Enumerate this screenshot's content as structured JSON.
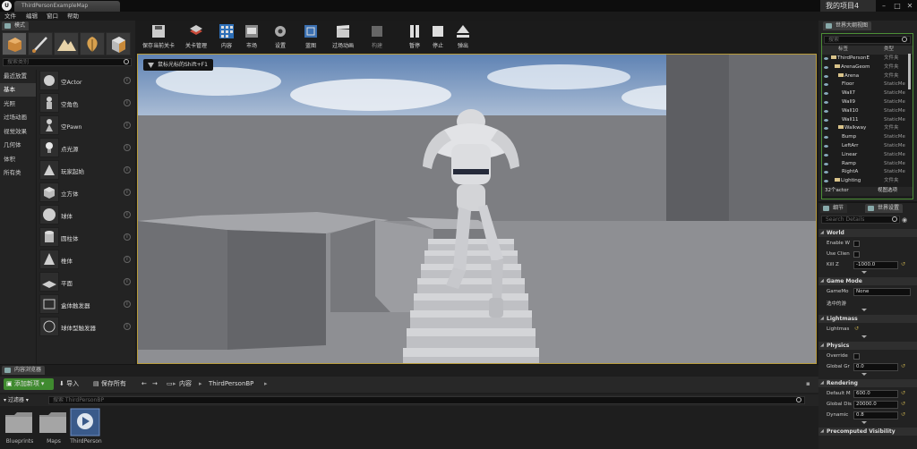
{
  "titlebar": {
    "doc_tab": "ThirdPersonExampleMap",
    "project": "我的项目4",
    "logo": "U"
  },
  "menu": [
    "文件",
    "编辑",
    "窗口",
    "帮助"
  ],
  "modes_panel": {
    "tab_label": "模式",
    "search_placeholder": "搜索类别",
    "categories": [
      "最近放置",
      "基本",
      "光照",
      "过场动画",
      "视觉效果",
      "几何体",
      "体积",
      "所有类"
    ],
    "items": [
      "空Actor",
      "空角色",
      "空Pawn",
      "点光源",
      "玩家起始",
      "立方体",
      "球体",
      "圆柱体",
      "椎体",
      "平面",
      "盒体触发器",
      "球体型触发器"
    ]
  },
  "toolbar": {
    "buttons": [
      "保存当前关卡",
      "关卡管理",
      "内容",
      "市场",
      "设置",
      "蓝图",
      "过场动画",
      "构建",
      "暂停",
      "停止",
      "弹出"
    ]
  },
  "viewport": {
    "hint": "鼠标光标的Shift+F1"
  },
  "outliner": {
    "tab_label": "世界大纲视图",
    "search_placeholder": "搜索",
    "col_label": "标签",
    "col_type": "类型",
    "rows": [
      {
        "name": "ThirdPersonE",
        "type": "文件夹"
      },
      {
        "name": "ArenaGeom",
        "type": "文件夹"
      },
      {
        "name": "Arena",
        "type": "文件夹"
      },
      {
        "name": "Floor",
        "type": "StaticMe"
      },
      {
        "name": "Wall7",
        "type": "StaticMe"
      },
      {
        "name": "Wall9",
        "type": "StaticMe"
      },
      {
        "name": "Wall10",
        "type": "StaticMe"
      },
      {
        "name": "Wall11",
        "type": "StaticMe"
      },
      {
        "name": "Walkway",
        "type": "文件夹"
      },
      {
        "name": "Bump",
        "type": "StaticMe"
      },
      {
        "name": "LeftArr",
        "type": "StaticMe"
      },
      {
        "name": "Linear",
        "type": "StaticMe"
      },
      {
        "name": "Ramp",
        "type": "StaticMe"
      },
      {
        "name": "RightA",
        "type": "StaticMe"
      },
      {
        "name": "Lighting",
        "type": "文件夹"
      }
    ],
    "count": "32个actor",
    "view_options": "视图选项"
  },
  "details": {
    "tab_details": "细节",
    "tab_world_settings": "世界设置",
    "search_placeholder": "Search Details",
    "sections": [
      {
        "title": "World",
        "rows": [
          {
            "label": "Enable W",
            "type": "check"
          },
          {
            "label": "Use Clien",
            "type": "check"
          },
          {
            "label": "Kill Z",
            "type": "input",
            "value": "-1000.0"
          }
        ]
      },
      {
        "title": "Game Mode",
        "rows": [
          {
            "label": "GameMo",
            "type": "select",
            "value": "None"
          },
          {
            "label": "选中的游",
            "type": "none"
          }
        ]
      },
      {
        "title": "Lightmass",
        "rows": [
          {
            "label": "Lightmas",
            "type": "reset"
          }
        ]
      },
      {
        "title": "Physics",
        "rows": [
          {
            "label": "Override",
            "type": "check"
          },
          {
            "label": "Global Gr",
            "type": "input",
            "value": "0.0"
          }
        ]
      },
      {
        "title": "Rendering",
        "rows": [
          {
            "label": "Default M",
            "type": "input",
            "value": "600.0"
          },
          {
            "label": "Global Dis",
            "type": "input",
            "value": "20000.0"
          },
          {
            "label": "Dynamic",
            "type": "input",
            "value": "0.8"
          }
        ]
      },
      {
        "title": "Precomputed Visibility",
        "rows": []
      }
    ]
  },
  "content_browser": {
    "tab_label": "内容浏览器",
    "add_new": "添加新项",
    "import": "导入",
    "save_all": "保存所有",
    "breadcrumb": [
      "内容",
      "ThirdPersonBP"
    ],
    "filters": "过滤器",
    "search_placeholder": "搜索 ThirdPersonBP",
    "assets": [
      "Blueprints",
      "Maps",
      "ThirdPerson"
    ]
  },
  "colors": {
    "accent_green": "#4c8f36",
    "viewport_border": "#b89b3a",
    "add_button": "#3f8a2f"
  }
}
